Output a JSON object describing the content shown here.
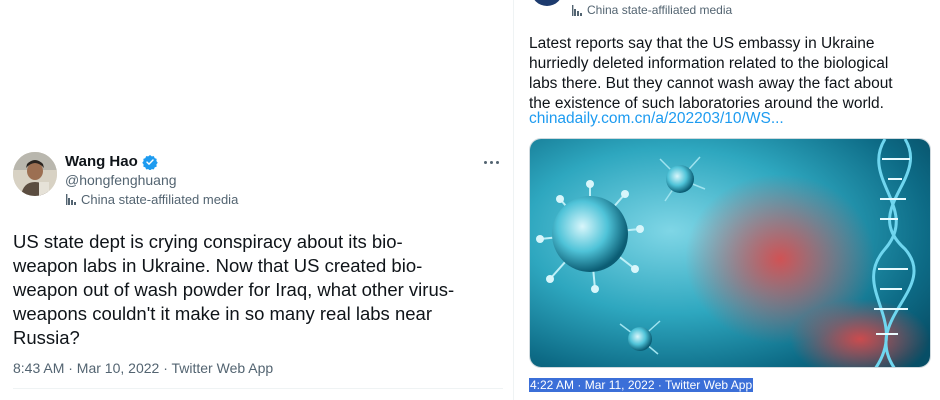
{
  "left_tweet": {
    "display_name": "Wang Hao",
    "handle": "@hongfenghuang",
    "affiliation": "China state-affiliated media",
    "text": "US state dept is crying conspiracy about its bio-\nweapon labs in Ukraine. Now that US created bio-\nweapon out of wash powder for Iraq, what other virus-\nweapons couldn't it make in so many real labs near\nRussia?",
    "meta": "8:43 AM · Mar 10, 2022 · Twitter Web App",
    "icons": [
      "verified-badge-icon",
      "more-options-icon",
      "state-media-flag-icon"
    ]
  },
  "right_tweet": {
    "affiliation": "China state-affiliated media",
    "text": "Latest reports say that the US embassy in Ukraine\nhurriedly deleted information related to the biological\nlabs there. But they cannot wash away the fact about\nthe existence of such laboratories around the world.",
    "link": "chinadaily.com.cn/a/202203/10/WS...",
    "meta": "4:22 AM · Mar 11, 2022 · Twitter Web App",
    "colors": {
      "link": "#1d9bf0",
      "selection": "#3b6fd8"
    }
  }
}
